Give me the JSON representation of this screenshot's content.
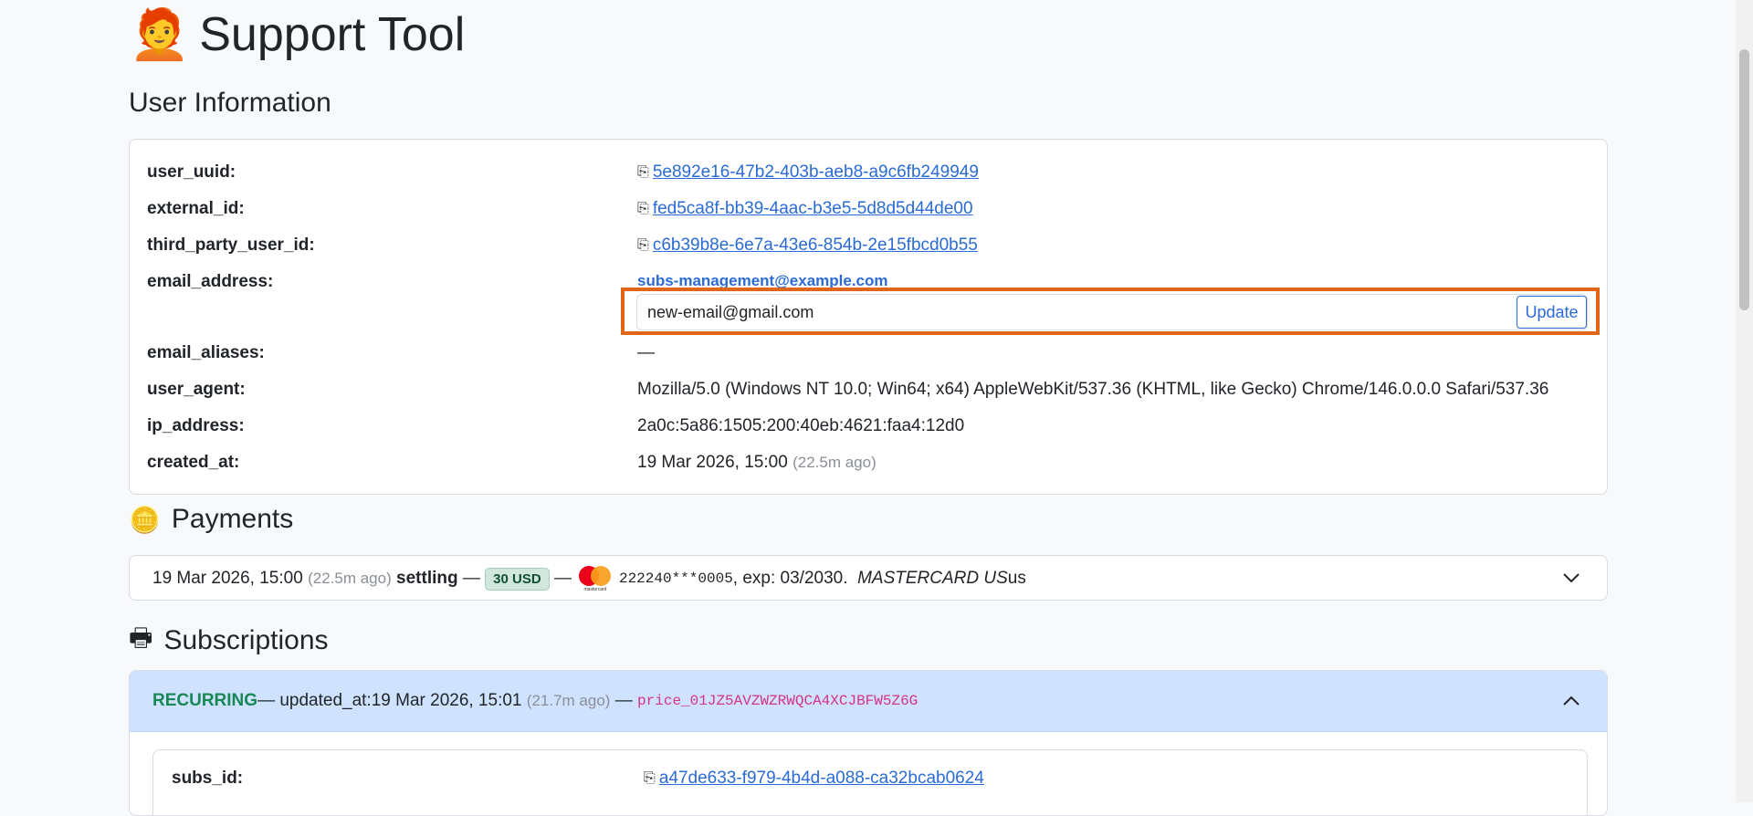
{
  "app": {
    "title": "Support Tool",
    "emoji": "🧑‍🦰"
  },
  "user_info": {
    "heading": "User Information",
    "fields": [
      {
        "label": "user_uuid:",
        "value": "5e892e16-47b2-403b-aeb8-a9c6fb249949"
      },
      {
        "label": "external_id:",
        "value": "fed5ca8f-bb39-4aac-b3e5-5d8d5d44de00"
      },
      {
        "label": "third_party_user_id:",
        "value": "c6b39b8e-6e7a-43e6-854b-2e15fbcd0b55"
      },
      {
        "label": "email_address:",
        "value": "subs-management@example.com"
      },
      {
        "label": "email_aliases:",
        "value": "—"
      },
      {
        "label": "user_agent:",
        "value": "Mozilla/5.0 (Windows NT 10.0; Win64; x64) AppleWebKit/537.36 (KHTML, like Gecko) Chrome/146.0.0.0 Safari/537.36"
      },
      {
        "label": "ip_address:",
        "value": "2a0c:5a86:1505:200:40eb:4621:faa4:12d0"
      },
      {
        "label": "created_at:",
        "value": "19 Mar 2026, 15:00",
        "ago": "(22.5m ago)"
      }
    ],
    "email_input": {
      "value": "new-email@gmail.com",
      "button": "Update"
    }
  },
  "payments": {
    "heading": "Payments",
    "row": {
      "date": "19 Mar 2026, 15:00",
      "ago": "(22.5m ago)",
      "status": "settling",
      "dash": "—",
      "amount": "30 USD",
      "card_brand_text": "mastercard",
      "card_number": "222240***0005",
      "exp": ", exp: 03/2030.",
      "issuer": "MASTERCARD US",
      "country": "us"
    }
  },
  "subscriptions": {
    "heading": "Subscriptions",
    "header": {
      "type": "RECURRING",
      "updated_prefix": "— updated_at:",
      "updated": "19 Mar 2026, 15:01",
      "ago": "(21.7m ago)",
      "dash": "—",
      "price": "price_01JZ5AVZWZRWQCA4XCJBFW5Z6G"
    },
    "fields": [
      {
        "label": "subs_id:",
        "value": "a47de633-f979-4b4d-a088-ca32bcab0624"
      }
    ]
  },
  "colors": {
    "accent": "#2a6bd6",
    "highlight": "#e06516",
    "sub_header_bg": "#cfe2ff",
    "recurring": "#198754",
    "price": "#d63384"
  }
}
